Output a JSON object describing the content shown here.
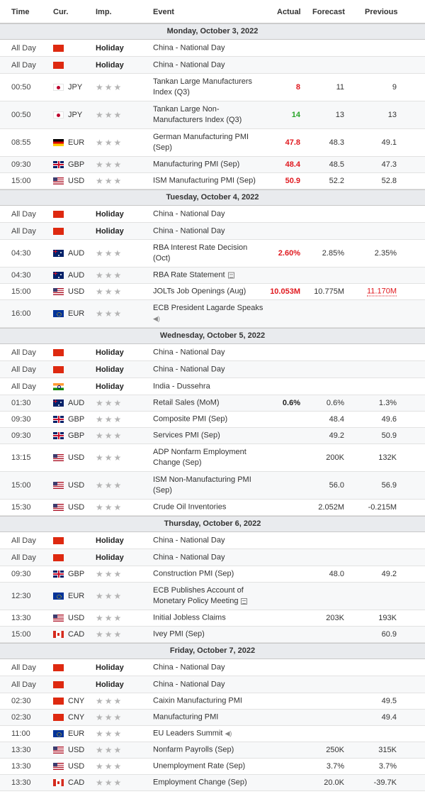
{
  "headers": {
    "time": "Time",
    "cur": "Cur.",
    "imp": "Imp.",
    "event": "Event",
    "actual": "Actual",
    "forecast": "Forecast",
    "previous": "Previous"
  },
  "days": [
    {
      "label": "Monday, October 3, 2022",
      "rows": [
        {
          "time": "All Day",
          "flag": "f-cn",
          "cur": "",
          "imp": "Holiday",
          "event": "China - National Day",
          "actual": "",
          "forecast": "",
          "previous": "",
          "h": 24
        },
        {
          "time": "All Day",
          "flag": "f-cn",
          "cur": "",
          "imp": "Holiday",
          "event": "China - National Day",
          "actual": "",
          "forecast": "",
          "previous": "",
          "h": 24
        },
        {
          "time": "00:50",
          "flag": "f-jp",
          "cur": "JPY",
          "imp": "stars",
          "event": "Tankan Large Manufacturers Index (Q3)",
          "actual": "8",
          "actualColor": "red",
          "forecast": "11",
          "previous": "9",
          "h": 39
        },
        {
          "time": "00:50",
          "flag": "f-jp",
          "cur": "JPY",
          "imp": "stars",
          "event": "Tankan Large Non-Manufacturers Index (Q3)",
          "actual": "14",
          "actualColor": "green",
          "forecast": "13",
          "previous": "13",
          "h": 39
        },
        {
          "time": "08:55",
          "flag": "f-de",
          "cur": "EUR",
          "imp": "stars",
          "event": "German Manufacturing PMI (Sep)",
          "actual": "47.8",
          "actualColor": "red",
          "forecast": "48.3",
          "previous": "49.1",
          "h": 39
        },
        {
          "time": "09:30",
          "flag": "f-gb",
          "cur": "GBP",
          "imp": "stars",
          "event": "Manufacturing PMI (Sep)",
          "actual": "48.4",
          "actualColor": "red",
          "forecast": "48.5",
          "previous": "47.3",
          "h": 23
        },
        {
          "time": "15:00",
          "flag": "f-us",
          "cur": "USD",
          "imp": "stars",
          "event": "ISM Manufacturing PMI (Sep)",
          "actual": "50.9",
          "actualColor": "red",
          "forecast": "52.2",
          "previous": "52.8",
          "h": 23
        }
      ]
    },
    {
      "label": "Tuesday, October 4, 2022",
      "rows": [
        {
          "time": "All Day",
          "flag": "f-cn",
          "cur": "",
          "imp": "Holiday",
          "event": "China - National Day",
          "actual": "",
          "forecast": "",
          "previous": "",
          "h": 24
        },
        {
          "time": "All Day",
          "flag": "f-cn",
          "cur": "",
          "imp": "Holiday",
          "event": "China - National Day",
          "actual": "",
          "forecast": "",
          "previous": "",
          "h": 24
        },
        {
          "time": "04:30",
          "flag": "f-au",
          "cur": "AUD",
          "imp": "stars",
          "event": "RBA Interest Rate Decision (Oct)",
          "actual": "2.60%",
          "actualColor": "red",
          "forecast": "2.85%",
          "previous": "2.35%",
          "h": 39
        },
        {
          "time": "04:30",
          "flag": "f-au",
          "cur": "AUD",
          "imp": "stars",
          "event": "RBA Rate Statement",
          "icon": "doc",
          "actual": "",
          "forecast": "",
          "previous": "",
          "h": 23
        },
        {
          "time": "15:00",
          "flag": "f-us",
          "cur": "USD",
          "imp": "stars",
          "event": "JOLTs Job Openings (Aug)",
          "actual": "10.053M",
          "actualColor": "red",
          "forecast": "10.775M",
          "previous": "11.170M",
          "prevRevised": true,
          "h": 23
        },
        {
          "time": "16:00",
          "flag": "f-eu",
          "cur": "EUR",
          "imp": "stars",
          "event": "ECB President Lagarde Speaks",
          "icon": "speaker-below",
          "actual": "",
          "forecast": "",
          "previous": "",
          "h": 39
        }
      ]
    },
    {
      "label": "Wednesday, October 5, 2022",
      "rows": [
        {
          "time": "All Day",
          "flag": "f-cn",
          "cur": "",
          "imp": "Holiday",
          "event": "China - National Day",
          "actual": "",
          "forecast": "",
          "previous": "",
          "h": 24
        },
        {
          "time": "All Day",
          "flag": "f-cn",
          "cur": "",
          "imp": "Holiday",
          "event": "China - National Day",
          "actual": "",
          "forecast": "",
          "previous": "",
          "h": 24
        },
        {
          "time": "All Day",
          "flag": "f-in",
          "cur": "",
          "imp": "Holiday",
          "event": "India - Dussehra",
          "actual": "",
          "forecast": "",
          "previous": "",
          "h": 24
        },
        {
          "time": "01:30",
          "flag": "f-au",
          "cur": "AUD",
          "imp": "stars",
          "event": "Retail Sales (MoM)",
          "actual": "0.6%",
          "actualColor": "black",
          "forecast": "0.6%",
          "previous": "1.3%",
          "h": 23
        },
        {
          "time": "09:30",
          "flag": "f-gb",
          "cur": "GBP",
          "imp": "stars",
          "event": "Composite PMI (Sep)",
          "actual": "",
          "forecast": "48.4",
          "previous": "49.6",
          "h": 23
        },
        {
          "time": "09:30",
          "flag": "f-gb",
          "cur": "GBP",
          "imp": "stars",
          "event": "Services PMI (Sep)",
          "actual": "",
          "forecast": "49.2",
          "previous": "50.9",
          "h": 23
        },
        {
          "time": "13:15",
          "flag": "f-us",
          "cur": "USD",
          "imp": "stars",
          "event": "ADP Nonfarm Employment Change (Sep)",
          "actual": "",
          "forecast": "200K",
          "previous": "132K",
          "h": 39
        },
        {
          "time": "15:00",
          "flag": "f-us",
          "cur": "USD",
          "imp": "stars",
          "event": "ISM Non-Manufacturing PMI (Sep)",
          "actual": "",
          "forecast": "56.0",
          "previous": "56.9",
          "h": 39
        },
        {
          "time": "15:30",
          "flag": "f-us",
          "cur": "USD",
          "imp": "stars",
          "event": "Crude Oil Inventories",
          "actual": "",
          "forecast": "2.052M",
          "previous": "-0.215M",
          "h": 23
        }
      ]
    },
    {
      "label": "Thursday, October 6, 2022",
      "rows": [
        {
          "time": "All Day",
          "flag": "f-cn",
          "cur": "",
          "imp": "Holiday",
          "event": "China - National Day",
          "actual": "",
          "forecast": "",
          "previous": "",
          "h": 24
        },
        {
          "time": "All Day",
          "flag": "f-cn",
          "cur": "",
          "imp": "Holiday",
          "event": "China - National Day",
          "actual": "",
          "forecast": "",
          "previous": "",
          "h": 24
        },
        {
          "time": "09:30",
          "flag": "f-gb",
          "cur": "GBP",
          "imp": "stars",
          "event": "Construction PMI (Sep)",
          "actual": "",
          "forecast": "48.0",
          "previous": "49.2",
          "h": 23
        },
        {
          "time": "12:30",
          "flag": "f-eu",
          "cur": "EUR",
          "imp": "stars",
          "event": "ECB Publishes Account of Monetary Policy Meeting",
          "icon": "doc",
          "actual": "",
          "forecast": "",
          "previous": "",
          "h": 39
        },
        {
          "time": "13:30",
          "flag": "f-us",
          "cur": "USD",
          "imp": "stars",
          "event": "Initial Jobless Claims",
          "actual": "",
          "forecast": "203K",
          "previous": "193K",
          "h": 23
        },
        {
          "time": "15:00",
          "flag": "f-ca",
          "cur": "CAD",
          "imp": "stars",
          "event": "Ivey PMI (Sep)",
          "actual": "",
          "forecast": "",
          "previous": "60.9",
          "h": 23
        }
      ]
    },
    {
      "label": "Friday, October 7, 2022",
      "rows": [
        {
          "time": "All Day",
          "flag": "f-cn",
          "cur": "",
          "imp": "Holiday",
          "event": "China - National Day",
          "actual": "",
          "forecast": "",
          "previous": "",
          "h": 24
        },
        {
          "time": "All Day",
          "flag": "f-cn",
          "cur": "",
          "imp": "Holiday",
          "event": "China - National Day",
          "actual": "",
          "forecast": "",
          "previous": "",
          "h": 24
        },
        {
          "time": "02:30",
          "flag": "f-cn",
          "cur": "CNY",
          "imp": "stars",
          "event": "Caixin Manufacturing PMI",
          "actual": "",
          "forecast": "",
          "previous": "49.5",
          "h": 23
        },
        {
          "time": "02:30",
          "flag": "f-cn",
          "cur": "CNY",
          "imp": "stars",
          "event": "Manufacturing PMI",
          "actual": "",
          "forecast": "",
          "previous": "49.4",
          "h": 23
        },
        {
          "time": "11:00",
          "flag": "f-eu",
          "cur": "EUR",
          "imp": "stars",
          "event": "EU Leaders Summit",
          "icon": "speaker",
          "actual": "",
          "forecast": "",
          "previous": "",
          "h": 23
        },
        {
          "time": "13:30",
          "flag": "f-us",
          "cur": "USD",
          "imp": "stars",
          "event": "Nonfarm Payrolls (Sep)",
          "actual": "",
          "forecast": "250K",
          "previous": "315K",
          "h": 23
        },
        {
          "time": "13:30",
          "flag": "f-us",
          "cur": "USD",
          "imp": "stars",
          "event": "Unemployment Rate (Sep)",
          "actual": "",
          "forecast": "3.7%",
          "previous": "3.7%",
          "h": 23
        },
        {
          "time": "13:30",
          "flag": "f-ca",
          "cur": "CAD",
          "imp": "stars",
          "event": "Employment Change (Sep)",
          "actual": "",
          "forecast": "20.0K",
          "previous": "-39.7K",
          "h": 23
        }
      ]
    }
  ]
}
